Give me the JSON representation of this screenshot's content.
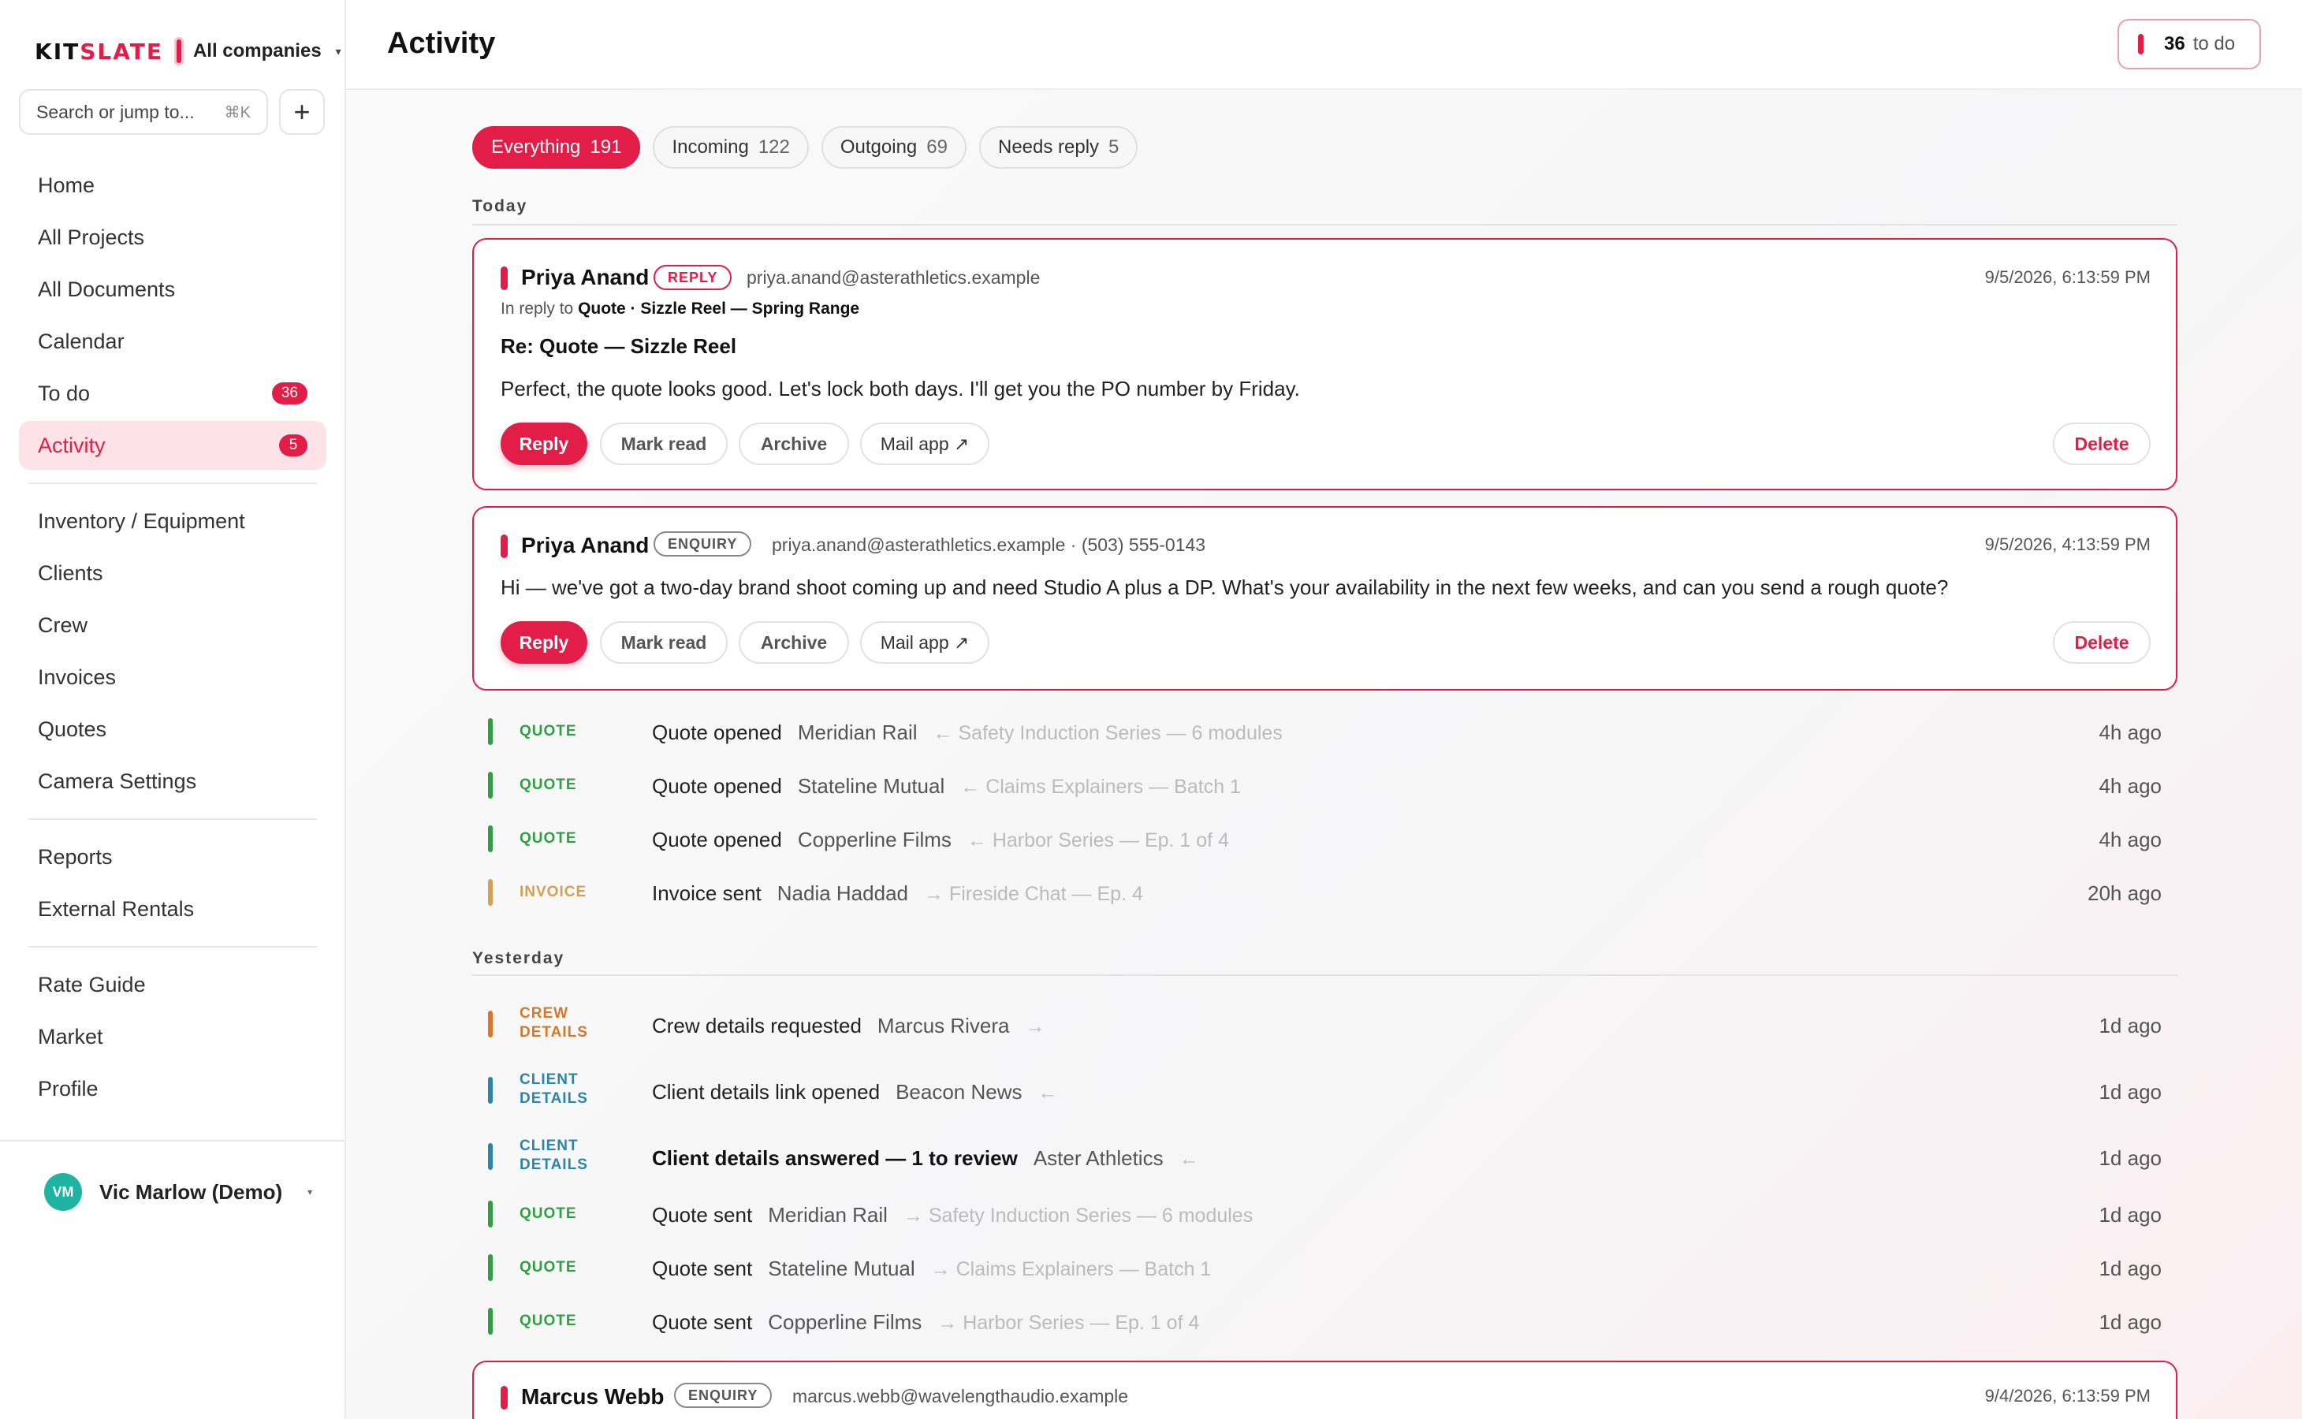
{
  "brand": {
    "logo_a": "KIT",
    "logo_b": "SLATE",
    "company": "All companies",
    "caret": "▾"
  },
  "search": {
    "placeholder": "Search or jump to...",
    "shortcut": "⌘K",
    "new_label": "+"
  },
  "nav": {
    "primary": [
      {
        "label": "Home"
      },
      {
        "label": "All Projects"
      },
      {
        "label": "All Documents"
      },
      {
        "label": "Calendar"
      },
      {
        "label": "To do",
        "badge": "36"
      },
      {
        "label": "Activity",
        "badge": "5",
        "active": true
      }
    ],
    "secondary": [
      {
        "label": "Inventory / Equipment"
      },
      {
        "label": "Clients"
      },
      {
        "label": "Crew"
      },
      {
        "label": "Invoices"
      },
      {
        "label": "Quotes"
      },
      {
        "label": "Camera Settings"
      }
    ],
    "tertiary": [
      {
        "label": "Reports"
      },
      {
        "label": "External Rentals"
      }
    ],
    "quaternary": [
      {
        "label": "Rate Guide"
      },
      {
        "label": "Market"
      },
      {
        "label": "Profile"
      }
    ]
  },
  "user": {
    "initials": "VM",
    "name": "Vic Marlow (Demo)",
    "caret": "▾"
  },
  "header": {
    "title": "Activity",
    "todo_count": "36",
    "todo_label": "to do"
  },
  "filters": [
    {
      "label": "Everything",
      "count": "191",
      "active": true
    },
    {
      "label": "Incoming",
      "count": "122"
    },
    {
      "label": "Outgoing",
      "count": "69"
    },
    {
      "label": "Needs reply",
      "count": "5"
    }
  ],
  "sections": {
    "today": "Today",
    "yesterday": "Yesterday"
  },
  "buttons": {
    "reply": "Reply",
    "mark_read": "Mark read",
    "archive": "Archive",
    "mail_app": "Mail app ↗",
    "delete": "Delete"
  },
  "cards": [
    {
      "name": "Priya Anand",
      "tag": "REPLY",
      "email": "priya.anand@asterathletics.example",
      "date": "9/5/2026, 6:13:59 PM",
      "in_reply_prefix": "In reply to",
      "in_reply_ref": "Quote · Sizzle Reel — Spring Range",
      "subject": "Re: Quote — Sizzle Reel",
      "body": "Perfect, the quote looks good. Let's lock both days. I'll get you the PO number by Friday."
    },
    {
      "name": "Priya Anand",
      "tag": "ENQUIRY",
      "email": "priya.anand@asterathletics.example · (503) 555-0143",
      "date": "9/5/2026, 4:13:59 PM",
      "body": "Hi — we've got a two-day brand shoot coming up and need Studio A plus a DP. What's your availability in the next few weeks, and can you send a rough quote?"
    },
    {
      "name": "Marcus Webb",
      "tag": "ENQUIRY",
      "email": "marcus.webb@wavelengthaudio.example",
      "date": "9/4/2026, 6:13:59 PM"
    }
  ],
  "today_rows": [
    {
      "type_1": "QUOTE",
      "type_2": "",
      "color": "#2f9e44",
      "action": "Quote opened",
      "who": "Meridian Rail",
      "ref": "← Safety Induction Series — 6 modules",
      "time": "4h ago"
    },
    {
      "type_1": "QUOTE",
      "type_2": "",
      "color": "#2f9e44",
      "action": "Quote opened",
      "who": "Stateline Mutual",
      "ref": "← Claims Explainers — Batch 1",
      "time": "4h ago"
    },
    {
      "type_1": "QUOTE",
      "type_2": "",
      "color": "#2f9e44",
      "action": "Quote opened",
      "who": "Copperline Films",
      "ref": "← Harbor Series — Ep. 1 of 4",
      "time": "4h ago"
    },
    {
      "type_1": "INVOICE",
      "type_2": "",
      "color": "#d4a056",
      "action": "Invoice sent",
      "who": "Nadia Haddad",
      "ref": "→ Fireside Chat — Ep. 4",
      "time": "20h ago"
    }
  ],
  "yesterday_rows": [
    {
      "type_1": "CREW",
      "type_2": "DETAILS",
      "color": "#d9772b",
      "action": "Crew details requested",
      "who": "Marcus Rivera",
      "ref": "→",
      "time": "1d ago"
    },
    {
      "type_1": "CLIENT",
      "type_2": "DETAILS",
      "color": "#2b86a8",
      "action": "Client details link opened",
      "who": "Beacon News",
      "ref": "←",
      "time": "1d ago"
    },
    {
      "type_1": "CLIENT",
      "type_2": "DETAILS",
      "color": "#2b86a8",
      "action": "Client details answered — 1 to review",
      "who": "Aster Athletics",
      "ref": "←",
      "time": "1d ago",
      "bold": true
    },
    {
      "type_1": "QUOTE",
      "type_2": "",
      "color": "#2f9e44",
      "action": "Quote sent",
      "who": "Meridian Rail",
      "ref": "→ Safety Induction Series — 6 modules",
      "time": "1d ago"
    },
    {
      "type_1": "QUOTE",
      "type_2": "",
      "color": "#2f9e44",
      "action": "Quote sent",
      "who": "Stateline Mutual",
      "ref": "→ Claims Explainers — Batch 1",
      "time": "1d ago"
    },
    {
      "type_1": "QUOTE",
      "type_2": "",
      "color": "#2f9e44",
      "action": "Quote sent",
      "who": "Copperline Films",
      "ref": "→ Harbor Series — Ep. 1 of 4",
      "time": "1d ago"
    }
  ]
}
